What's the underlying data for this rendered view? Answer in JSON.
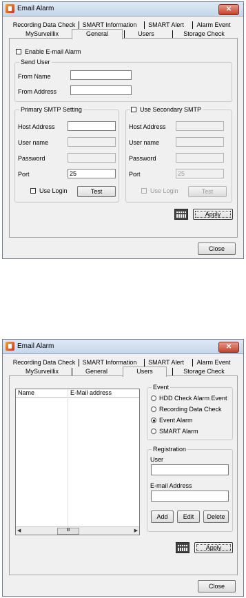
{
  "window1": {
    "title": "Email Alarm",
    "close_glyph": "✕",
    "tabs_row1": [
      "Recording Data Check",
      "SMART Information",
      "SMART Alert",
      "Alarm Event"
    ],
    "tabs_row2": [
      "MySurveillix",
      "General",
      "Users",
      "Storage Check"
    ],
    "active_tab": "General",
    "enable_email_alarm": "Enable E-mail Alarm",
    "send_user": {
      "title": "Send User",
      "from_name_label": "From Name",
      "from_name_value": "",
      "from_address_label": "From Address",
      "from_address_value": ""
    },
    "primary_smtp": {
      "title": "Primary SMTP Setting",
      "host_label": "Host Address",
      "user_label": "User name",
      "password_label": "Password",
      "port_label": "Port",
      "port_value": "25",
      "use_login": "Use Login",
      "test": "Test"
    },
    "secondary_smtp": {
      "title": "Use Secondary SMTP",
      "host_label": "Host Address",
      "user_label": "User name",
      "password_label": "Password",
      "port_label": "Port",
      "port_value": "25",
      "use_login": "Use Login",
      "test": "Test"
    },
    "apply": "Apply",
    "close": "Close",
    "keyboard_icon": "keyboard-icon"
  },
  "window2": {
    "title": "Email Alarm",
    "close_glyph": "✕",
    "tabs_row1": [
      "Recording Data Check",
      "SMART Information",
      "SMART Alert",
      "Alarm Event"
    ],
    "tabs_row2": [
      "MySurveillix",
      "General",
      "Users",
      "Storage Check"
    ],
    "active_tab": "Users",
    "list_columns": [
      "Name",
      "E-Mail address"
    ],
    "scroll_thumb": "III",
    "event": {
      "title": "Event",
      "options": [
        "HDD Check Alarm Event",
        "Recording Data Check",
        "Event Alarm",
        "SMART Alarm"
      ],
      "selected": "Event Alarm"
    },
    "registration": {
      "title": "Registration",
      "user_label": "User",
      "user_value": "",
      "email_label": "E-mail Address",
      "email_value": "",
      "add": "Add",
      "edit": "Edit",
      "delete": "Delete"
    },
    "apply": "Apply",
    "close": "Close",
    "keyboard_icon": "keyboard-icon"
  },
  "colors": {
    "titlebar": "#c5d6ea",
    "close_button": "#c4432b",
    "dialog_bg": "#f0f0f0"
  }
}
